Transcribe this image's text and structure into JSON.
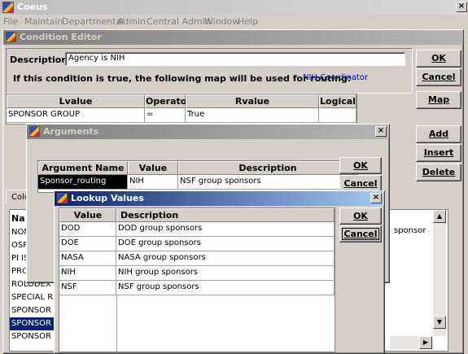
{
  "app": {
    "title": "Coeus"
  },
  "menu": [
    "File",
    "Maintain",
    "Departmental",
    "Admin",
    "Central Admin",
    "Window",
    "Help"
  ],
  "condition_editor": {
    "title": "Condition Editor",
    "description_label": "Description:",
    "description_value": "Agency is NIH",
    "routing_text": "If this condition is true, the following map will be used for routing:",
    "map_name": "NIH Coordinator",
    "columns": [
      "Lvalue",
      "Operator",
      "Rvalue",
      "Logical"
    ],
    "row": {
      "lvalue": "SPONSOR GROUP",
      "operator": "=",
      "rvalue": "True",
      "logical": ""
    },
    "buttons": {
      "ok": "OK",
      "cancel": "Cancel",
      "map": "Map",
      "add": "Add",
      "insert": "Insert",
      "delete": "Delete"
    },
    "lower_tab_label": "Colu",
    "list_header": "Na",
    "list_items": [
      "NON",
      "OSP",
      "PI IS",
      "PRO",
      "ROLODEX F",
      "SPECIAL RE",
      "SPONSOR (",
      "SPONSOR (",
      "SPONSOR T"
    ],
    "right_list_text": "sponsor"
  },
  "arguments": {
    "title": "Arguments",
    "columns": [
      "Argument Name",
      "Value",
      "Description"
    ],
    "row": {
      "name": "Sponsor_routing",
      "value": "NIH",
      "description": "NSF group sponsors"
    },
    "buttons": {
      "ok": "OK",
      "cancel": "Cancel"
    }
  },
  "lookup": {
    "title": "Lookup Values",
    "columns": [
      "Value",
      "Description"
    ],
    "rows": [
      {
        "value": "DOD",
        "description": "DOD group sponsors"
      },
      {
        "value": "DOE",
        "description": "DOE group sponsors"
      },
      {
        "value": "NASA",
        "description": "NASA group sponsors"
      },
      {
        "value": "NIH",
        "description": "NIH group sponsors"
      },
      {
        "value": "NSF",
        "description": "NSF group sponsors"
      }
    ],
    "buttons": {
      "ok": "OK",
      "cancel": "Cancel"
    }
  },
  "colors": {
    "active_title": "#0a246a",
    "selection": "#0a246a",
    "link_blue": "#0000cc"
  }
}
